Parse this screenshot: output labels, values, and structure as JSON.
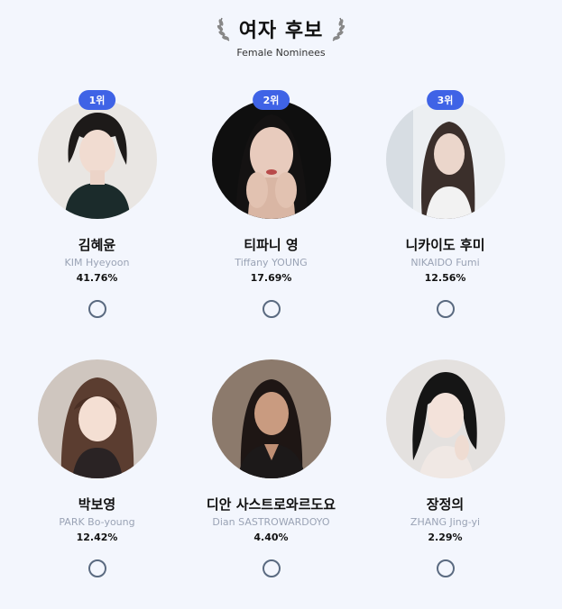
{
  "header": {
    "title": "여자 후보",
    "subtitle": "Female Nominees"
  },
  "nominees": [
    {
      "rank": "1위",
      "name": "김혜윤",
      "en": "KIM Hyeyoon",
      "pct": "41.76%"
    },
    {
      "rank": "2위",
      "name": "티파니 영",
      "en": "Tiffany YOUNG",
      "pct": "17.69%"
    },
    {
      "rank": "3위",
      "name": "니카이도 후미",
      "en": "NIKAIDO Fumi",
      "pct": "12.56%"
    },
    {
      "rank": "",
      "name": "박보영",
      "en": "PARK Bo-young",
      "pct": "12.42%"
    },
    {
      "rank": "",
      "name": "디안 사스트로와르도요",
      "en": "Dian SASTROWARDOYO",
      "pct": "4.40%"
    },
    {
      "rank": "",
      "name": "장정의",
      "en": "ZHANG Jing-yi",
      "pct": "2.29%"
    }
  ],
  "colors": {
    "accent": "#3f63e6",
    "background": "#f3f6fd",
    "radio": "#5a6a80"
  }
}
